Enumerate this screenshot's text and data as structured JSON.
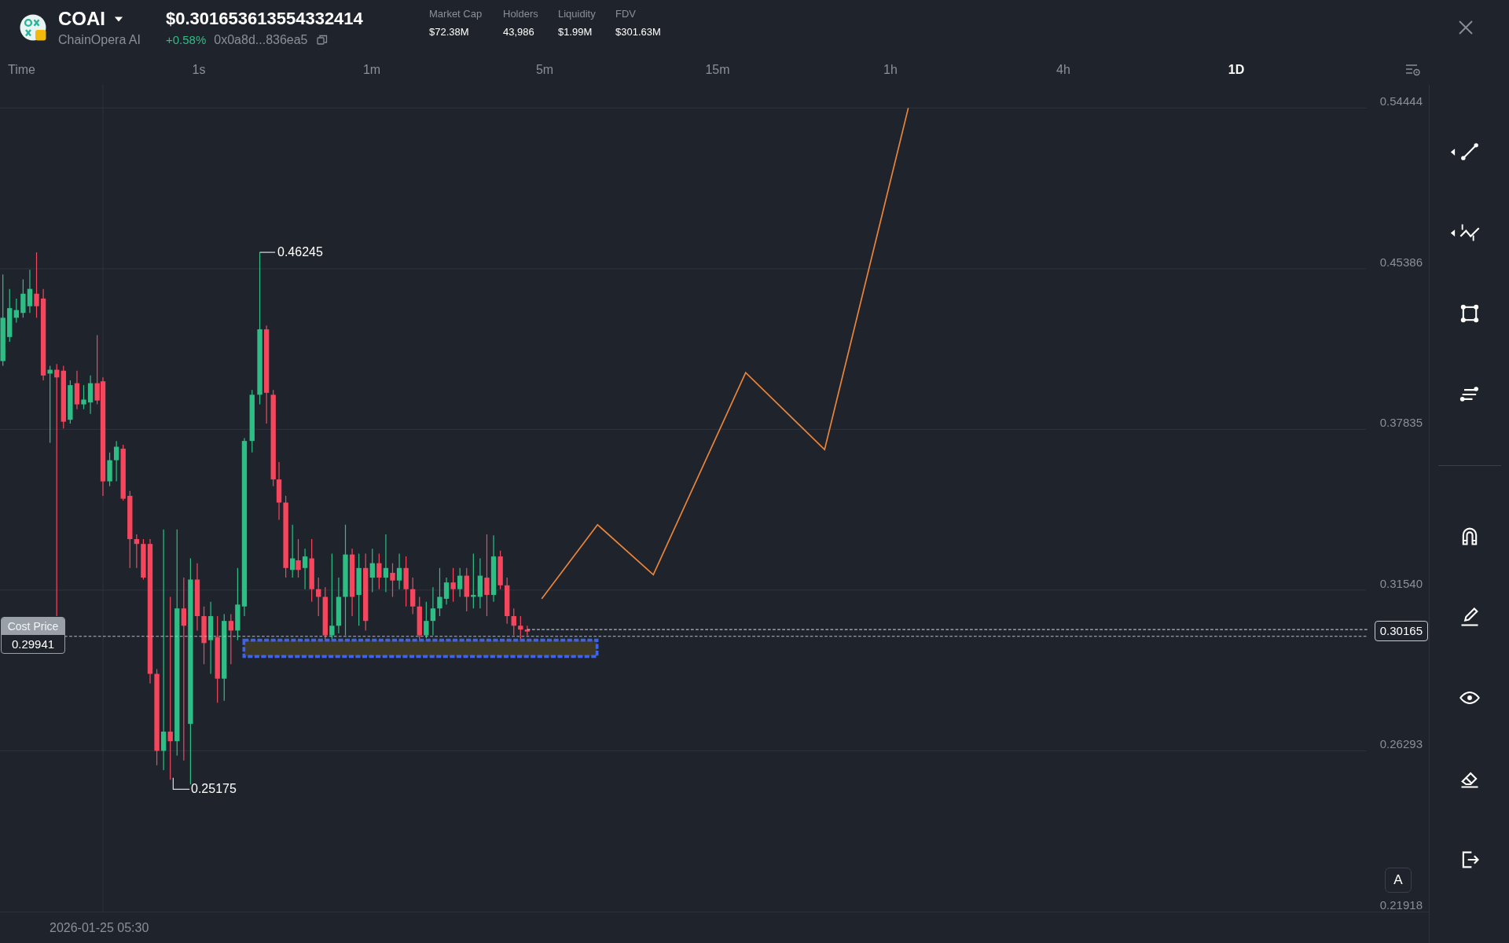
{
  "token": {
    "symbol": "COAI",
    "name": "ChainOpera AI",
    "price": "$0.301653613554332414",
    "change": "+0.58%",
    "address": "0x0a8d...836ea5"
  },
  "stats": [
    {
      "label": "Market Cap",
      "value": "$72.38M"
    },
    {
      "label": "Holders",
      "value": "43,986"
    },
    {
      "label": "Liquidity",
      "value": "$1.99M"
    },
    {
      "label": "FDV",
      "value": "$301.63M"
    }
  ],
  "time_label": "Time",
  "timeframes": [
    {
      "label": "1s",
      "selected": false
    },
    {
      "label": "1m",
      "selected": false
    },
    {
      "label": "5m",
      "selected": false
    },
    {
      "label": "15m",
      "selected": false
    },
    {
      "label": "1h",
      "selected": false
    },
    {
      "label": "4h",
      "selected": false
    },
    {
      "label": "1D",
      "selected": true
    }
  ],
  "price_axis": [
    "0.54444",
    "0.45386",
    "0.37835",
    "0.31540",
    "0.26293",
    "0.21918"
  ],
  "chart": {
    "high_label": "0.46245",
    "low_label": "0.25175",
    "cost_price": {
      "label": "Cost Price",
      "value": "0.29941"
    },
    "current_price": "0.30165",
    "scale_button": "A",
    "date_label": "2026-01-25 05:30"
  },
  "drawing_tools": [
    {
      "kind": "trend-line",
      "submenu": true
    },
    {
      "kind": "zigzag",
      "submenu": true
    },
    {
      "kind": "rectangle",
      "submenu": false
    },
    {
      "kind": "text-lines",
      "submenu": false
    }
  ],
  "view_tools": [
    {
      "kind": "magnet"
    },
    {
      "kind": "pencil"
    },
    {
      "kind": "eye"
    },
    {
      "kind": "eraser"
    },
    {
      "kind": "exit"
    }
  ]
}
